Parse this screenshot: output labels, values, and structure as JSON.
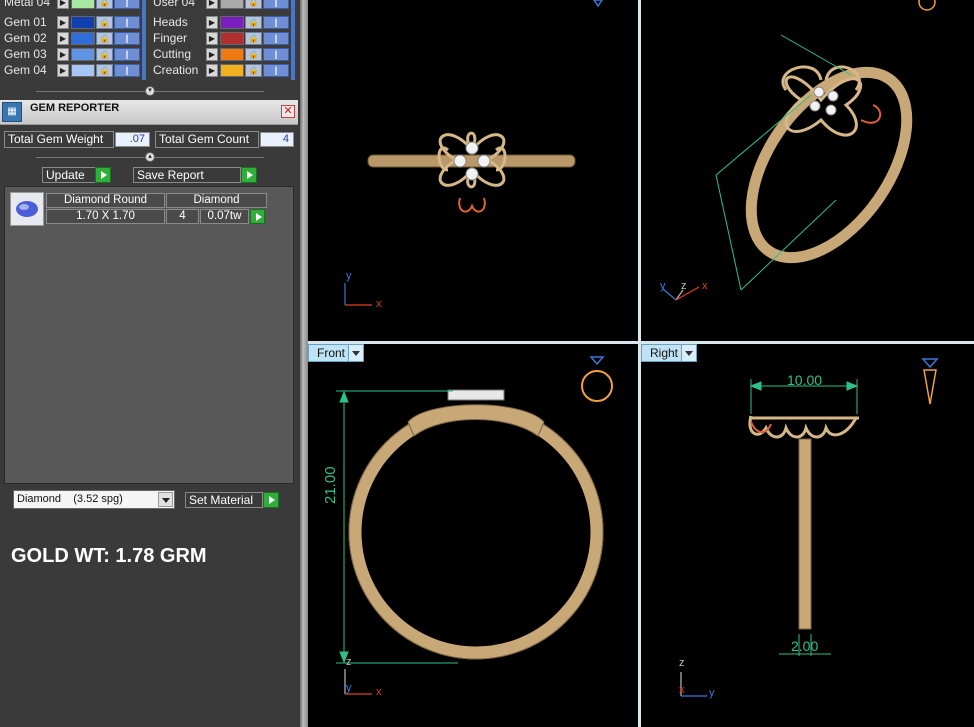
{
  "layers_left": [
    {
      "name": "Metal 04",
      "color": "#a8e8a0"
    },
    {
      "name": "Gem 01",
      "color": "#1040b0"
    },
    {
      "name": "Gem 02",
      "color": "#2f6ed8"
    },
    {
      "name": "Gem 03",
      "color": "#5e93e6"
    },
    {
      "name": "Gem 04",
      "color": "#a8c6f4"
    }
  ],
  "layers_right": [
    {
      "name": "User 04",
      "color": "#aaaaaa"
    },
    {
      "name": "Heads",
      "color": "#7a1ec0"
    },
    {
      "name": "Finger",
      "color": "#b03030"
    },
    {
      "name": "Cutting",
      "color": "#f07a10"
    },
    {
      "name": "Creation",
      "color": "#f0b020"
    }
  ],
  "gem_reporter": {
    "title": "GEM REPORTER",
    "total_weight_label": "Total Gem Weight",
    "total_weight_value": ".07",
    "total_count_label": "Total Gem Count",
    "total_count_value": "4",
    "update_label": "Update",
    "save_report_label": "Save Report",
    "gem_row": {
      "name": "Diamond Round",
      "material": "Diamond",
      "size": "1.70 X 1.70",
      "count": "4",
      "weight": "0.07tw"
    },
    "material_select": "Diamond    (3.52 spg)",
    "set_material_label": "Set Material"
  },
  "gold_weight_text": "GOLD WT: 1.78 GRM",
  "viewports": {
    "top": {
      "axis1": "y",
      "axis2": "x"
    },
    "perspective": {
      "axis1": "y",
      "axis2": "z",
      "axis3": "x"
    },
    "front": {
      "label": "Front",
      "dimension": "21.00",
      "axis1": "z",
      "axis2": "y",
      "axis3": "x"
    },
    "right": {
      "label": "Right",
      "dimension_top": "10.00",
      "dimension_bottom": "2.00",
      "axis1": "z",
      "axis2": "x",
      "axis3": "y"
    }
  },
  "colors": {
    "metal": "#c9a878",
    "dimension": "#2ec08a",
    "axis_x": "#e04020",
    "axis_y": "#3a78d8",
    "axis_z": "#bbbbbb"
  }
}
